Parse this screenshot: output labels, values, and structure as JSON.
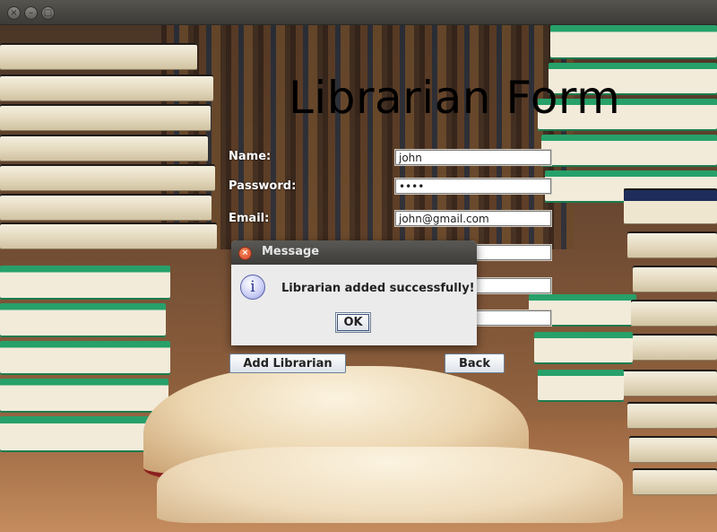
{
  "form": {
    "title": "Librarian Form",
    "fields": [
      {
        "label": "Name:",
        "value": "john"
      },
      {
        "label": "Password:",
        "value": "••••"
      },
      {
        "label": "Email:",
        "value": "john@gmail.com"
      },
      {
        "label": "",
        "value": ""
      },
      {
        "label": "",
        "value": ""
      },
      {
        "label": "",
        "value": ""
      }
    ],
    "add_button": "Add Librarian",
    "back_button": "Back"
  },
  "dialog": {
    "title": "Message",
    "message": "Librarian added successfully!",
    "ok_button": "OK",
    "icon": "info-icon"
  },
  "window": {
    "controls": [
      "close-icon",
      "minimize-icon",
      "maximize-icon"
    ]
  }
}
